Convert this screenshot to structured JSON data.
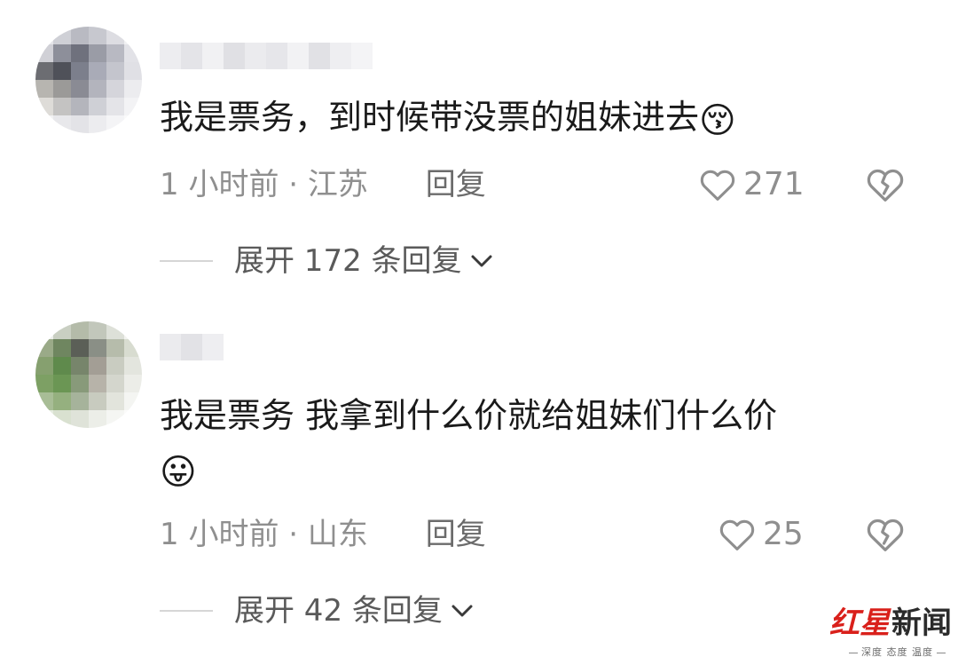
{
  "comments": [
    {
      "text": "我是票务，到时候带没票的姐妹进去",
      "emoji": "😚",
      "emoji_icon": "kiss-heart-eyes-emoji",
      "time": "1 小时前",
      "separator": "·",
      "location": "江苏",
      "reply_label": "回复",
      "likes": "271",
      "expand_label": "展开 172 条回复"
    },
    {
      "text": "我是票务 我拿到什么价就给姐妹们什么价",
      "emoji": "😛",
      "emoji_icon": "heart-eyes-tongue-emoji",
      "time": "1 小时前",
      "separator": "·",
      "location": "山东",
      "reply_label": "回复",
      "likes": "25",
      "expand_label": "展开 42 条回复"
    }
  ],
  "watermark": {
    "brand_red": "红星",
    "brand_dark": "新闻",
    "slogan": "深度 态度 温度"
  },
  "colors": {
    "text": "#1a1a1a",
    "meta": "#8f8f8f",
    "brand": "#d9201b"
  }
}
